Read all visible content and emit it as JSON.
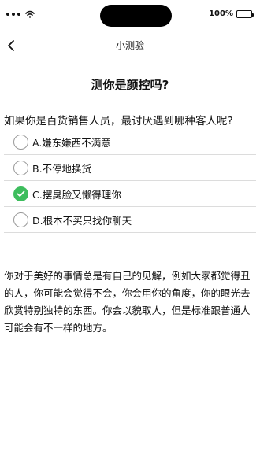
{
  "status_bar": {
    "battery_text": "100%",
    "battery_level": 1.0
  },
  "nav": {
    "back_icon": "chevron-left-icon",
    "title": "小测验"
  },
  "quiz": {
    "title": "测你是颜控吗?",
    "question": "如果你是百货销售人员，最讨厌遇到哪种客人呢?",
    "options": [
      {
        "label": "A.嫌东嫌西不满意",
        "selected": false
      },
      {
        "label": "B.不停地换货",
        "selected": false
      },
      {
        "label": "C.摆臭脸又懒得理你",
        "selected": true
      },
      {
        "label": "D.根本不买只找你聊天",
        "selected": false
      }
    ],
    "explanation": "你对于美好的事情总是有自己的见解，例如大家都觉得丑的人，你可能会觉得不会，你会用你的角度，你的眼光去欣赏特别独特的东西。你会以貌取人，但是标准跟普通人可能会有不一样的地方。"
  },
  "colors": {
    "selected_radio": "#3dbd5d",
    "divider": "#dcdcdc"
  }
}
